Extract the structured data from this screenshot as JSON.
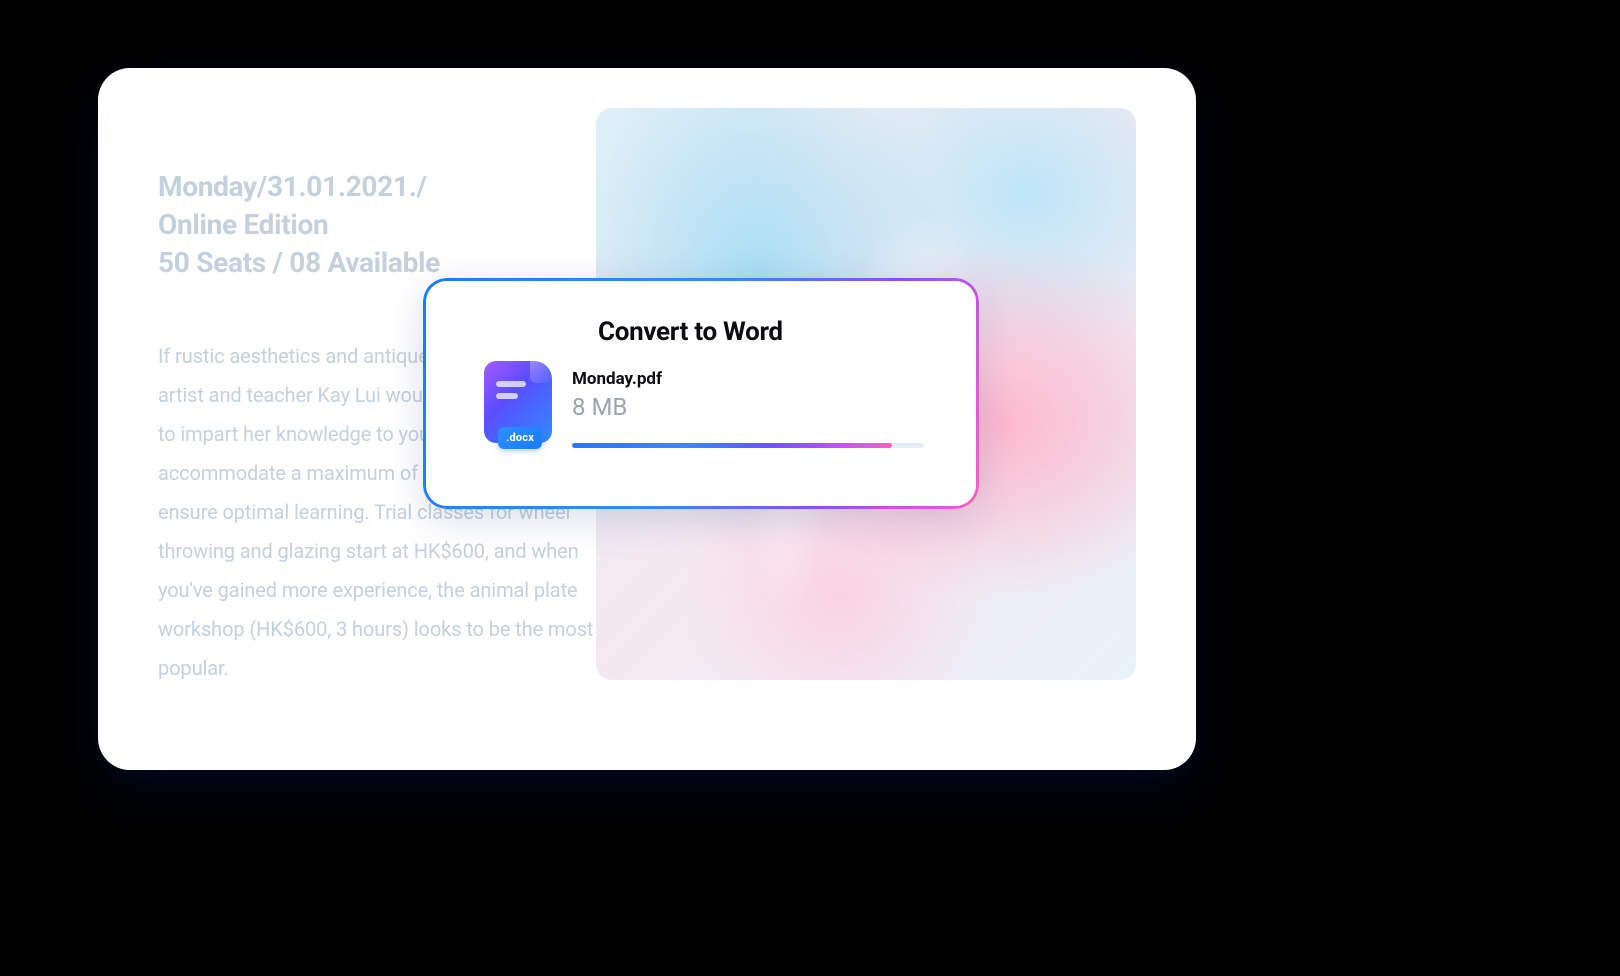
{
  "document": {
    "heading_line1": "Monday/31.01.2021./",
    "heading_line2": "Online Edition",
    "heading_line3": "50 Seats / 08 Available",
    "body": "If rustic aesthetics and antique accents are your thing, artist and teacher Kay Lui would be more than happy to impart her knowledge to you. Her classes accommodate a maximum of four students only to ensure optimal learning. Trial classes for wheel throwing and glazing start at HK$600, and when you've gained more experience, the animal plate workshop (HK$600, 3 hours) looks to be the most popular."
  },
  "dialog": {
    "title": "Convert to Word",
    "file_icon_badge": ".docx",
    "file_name": "Monday.pdf",
    "file_size": "8 MB",
    "progress_percent": 91
  },
  "colors": {
    "gradient_start": "#1b7cff",
    "gradient_mid": "#6d50ff",
    "gradient_end": "#ff5ec0",
    "muted_text": "#c4d0dc"
  }
}
